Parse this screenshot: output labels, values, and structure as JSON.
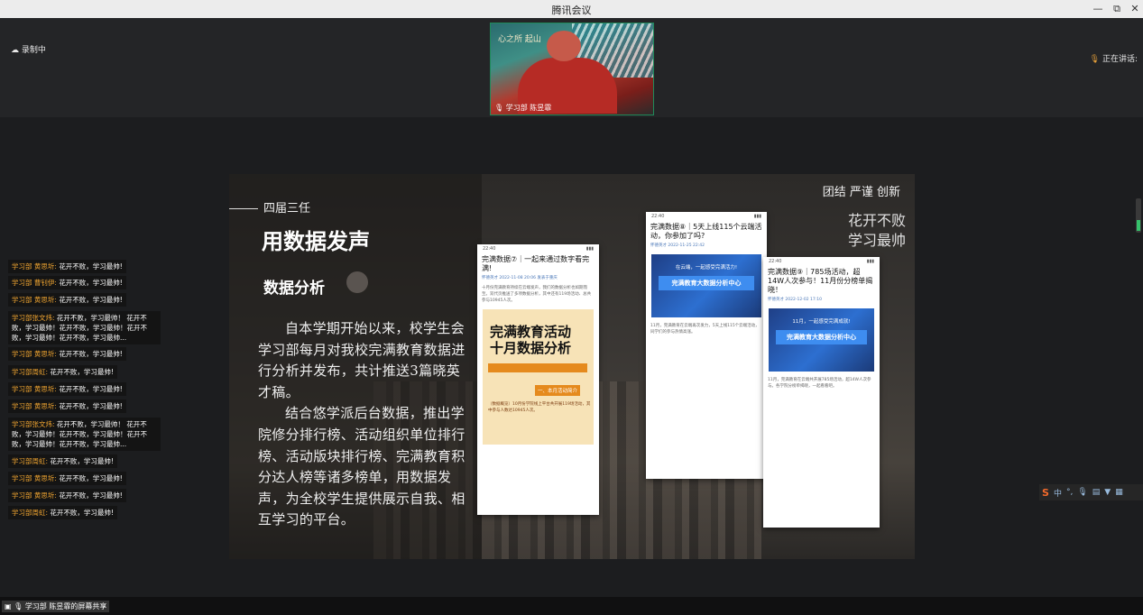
{
  "window": {
    "title": "腾讯会议",
    "min": "—",
    "max": "⧉",
    "close": "✕"
  },
  "status": {
    "recording": "录制中",
    "speaking": "正在讲话:"
  },
  "video": {
    "participant": "学习部 陈昱霏",
    "signature": "心之所 起山"
  },
  "slide": {
    "subtitle": "四届三任",
    "title": "用数据发声",
    "section": "数据分析",
    "para1": "自本学期开始以来，校学生会学习部每月对我校完满教育数据进行分析并发布，共计推送3篇晓英才稿。",
    "para2": "结合悠学派后台数据，推出学院修分排行榜、活动组织单位排行榜、活动版块排行榜、完满教育积分达人榜等诸多榜单，用数据发声，为全校学生提供展示自我、相互学习的平台。",
    "motto": "团结 严谨 创新",
    "slogan1": "花开不败",
    "slogan2": "学习最帅",
    "phones": [
      {
        "time": "22:40",
        "title": "完满数据⑦｜一起来通过数字看完满!",
        "meta": "怀德英才 2022-11-08 20:06 发表于重庆",
        "text": "十月份完满教育持续在云端发声，我们的数据分析也如期而至。双代页推送了多项数据分析，其中还有119场活动、总共参与10945人次。",
        "poster1": "完满教育活动",
        "poster2": "十月数据分析",
        "tag": "一、本月活动简介",
        "poster_text": "（数据概览）10月份学院线上平台共开展119场活动，其中参与人数达10945人次。"
      },
      {
        "time": "22:40",
        "title": "完满数据⑧｜5天上线115个云端活动，你参加了吗?",
        "meta": "怀德英才 2022-11-25 22:42",
        "banner1": "在云端，一起感受完满活力!",
        "banner2": "完满教育大数据分析中心",
        "text": "11月，完满教育在云端再次发力，5天上线115个云端活动，同学们的参与热情高涨。"
      },
      {
        "time": "22:40",
        "title": "完满数据⑨｜785场活动，超14W人次参与！11月份分榜单揭晓！",
        "meta": "怀德英才 2022-12-02 17:10",
        "banner1": "11月，一起感受完满成就!",
        "banner2": "完满教育大数据分析中心",
        "text": "11月，完满教育在云端共开展785场活动，超14W人次参与。各学院分榜单揭晓，一起看看吧。"
      }
    ]
  },
  "chat": [
    {
      "who": "学习部 黄思圻:",
      "msg": "花开不败，学习最帅!"
    },
    {
      "who": "学习部 曹钊伊:",
      "msg": "花开不败，学习最帅!"
    },
    {
      "who": "学习部 黄思圻:",
      "msg": "花开不败，学习最帅!"
    },
    {
      "who": "学习部张文炜:",
      "msg": "花开不败，学习最帅！ 花开不败，学习最帅！花开不败，学习最帅！花开不败，学习最帅！花开不败，学习最帅..."
    },
    {
      "who": "学习部 黄思圻:",
      "msg": "花开不败，学习最帅!"
    },
    {
      "who": "学习部周虹:",
      "msg": "花开不败，学习最帅!"
    },
    {
      "who": "学习部 黄思圻:",
      "msg": "花开不败，学习最帅!"
    },
    {
      "who": "学习部 黄思圻:",
      "msg": "花开不败，学习最帅!"
    },
    {
      "who": "学习部张文炜:",
      "msg": "花开不败，学习最帅！ 花开不败，学习最帅！花开不败，学习最帅！花开不败，学习最帅！花开不败，学习最帅..."
    },
    {
      "who": "学习部周虹:",
      "msg": "花开不败，学习最帅!"
    },
    {
      "who": "学习部 黄思圻:",
      "msg": "花开不败，学习最帅!"
    },
    {
      "who": "学习部 黄思圻:",
      "msg": "花开不败，学习最帅!"
    },
    {
      "who": "学习部周虹:",
      "msg": "花开不败，学习最帅!"
    }
  ],
  "tools": {
    "ime": "中"
  },
  "share": {
    "label": "学习部 陈昱霏的屏幕共享"
  }
}
